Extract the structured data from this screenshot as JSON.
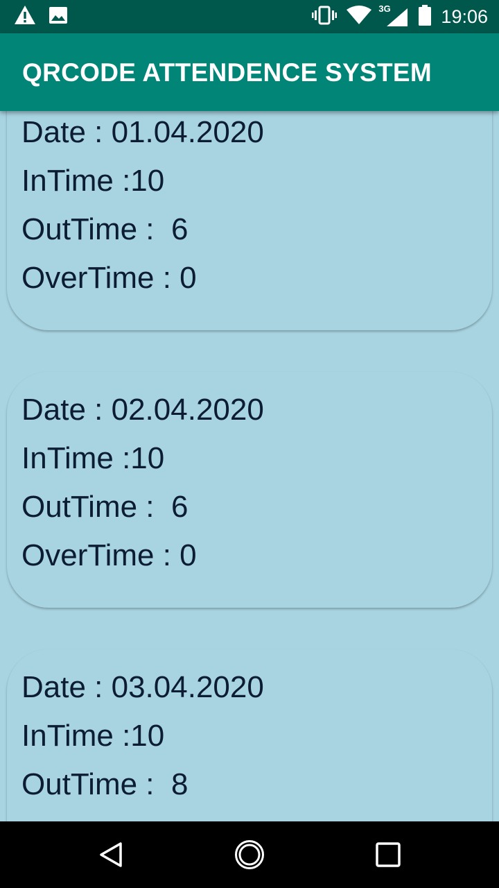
{
  "status_bar": {
    "time": "19:06",
    "network_type": "3G",
    "left_icons": [
      "warning-icon",
      "image-icon"
    ],
    "right_icons": [
      "vibrate-icon",
      "wifi-icon",
      "signal-icon",
      "battery-icon"
    ]
  },
  "app_bar": {
    "title": "QRCODE ATTENDENCE SYSTEM",
    "color": "#008577"
  },
  "records": [
    {
      "date": "Date : 01.04.2020",
      "in_time": "InTime :10",
      "out_time": "OutTime :  6",
      "over_time": "OverTime : 0"
    },
    {
      "date": "Date : 02.04.2020",
      "in_time": "InTime :10",
      "out_time": "OutTime :  6",
      "over_time": "OverTime : 0"
    },
    {
      "date": "Date : 03.04.2020",
      "in_time": "InTime :10",
      "out_time": "OutTime :  8"
    }
  ],
  "colors": {
    "background": "#a8d4e2",
    "status_bar": "#00574b",
    "text": "#0c1c33"
  },
  "nav_bar": {
    "buttons": [
      "back-icon",
      "home-icon",
      "recents-icon"
    ]
  }
}
